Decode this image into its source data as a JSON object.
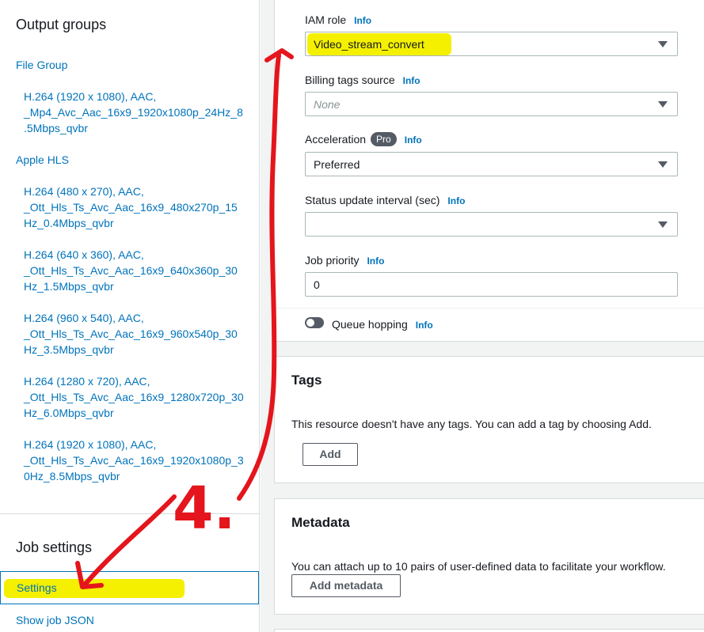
{
  "nav": {
    "output_groups_heading": "Output groups",
    "file_group": {
      "label": "File Group",
      "outputs": [
        "H.264 (1920 x 1080), AAC, _Mp4_Avc_Aac_16x9_1920x1080p_24Hz_8 .5Mbps_qvbr"
      ]
    },
    "apple_hls": {
      "label": "Apple HLS",
      "outputs": [
        "H.264 (480 x 270), AAC, _Ott_Hls_Ts_Avc_Aac_16x9_480x270p_15 Hz_0.4Mbps_qvbr",
        "H.264 (640 x 360), AAC, _Ott_Hls_Ts_Avc_Aac_16x9_640x360p_30 Hz_1.5Mbps_qvbr",
        "H.264 (960 x 540), AAC, _Ott_Hls_Ts_Avc_Aac_16x9_960x540p_30 Hz_3.5Mbps_qvbr",
        "H.264 (1280 x 720), AAC, _Ott_Hls_Ts_Avc_Aac_16x9_1280x720p_30 Hz_6.0Mbps_qvbr",
        "H.264 (1920 x 1080), AAC, _Ott_Hls_Ts_Avc_Aac_16x9_1920x1080p_3 0Hz_8.5Mbps_qvbr"
      ]
    },
    "job_settings_heading": "Job settings",
    "settings": "Settings",
    "show_job_json": "Show job JSON"
  },
  "form": {
    "info": "Info",
    "iam_role": {
      "label": "IAM role",
      "value": "Video_stream_convert"
    },
    "billing_tags": {
      "label": "Billing tags source",
      "placeholder": "None"
    },
    "acceleration": {
      "label": "Acceleration",
      "badge": "Pro",
      "value": "Preferred"
    },
    "status_interval": {
      "label": "Status update interval (sec)",
      "value": ""
    },
    "job_priority": {
      "label": "Job priority",
      "value": "0"
    },
    "queue_hopping": {
      "label": "Queue hopping",
      "enabled": false
    }
  },
  "tags": {
    "title": "Tags",
    "description": "This resource doesn't have any tags. You can add a tag by choosing Add.",
    "add_button": "Add"
  },
  "metadata": {
    "title": "Metadata",
    "description": "You can attach up to 10 pairs of user-defined data to facilitate your workflow.",
    "add_button": "Add metadata"
  },
  "annotation": {
    "step_label": "4.",
    "highlight_color": "#f4f000",
    "arrow_color": "#e4151c"
  },
  "colors": {
    "link": "#0073bb",
    "text": "#16191f",
    "panel_bg": "#f2f3f3"
  }
}
